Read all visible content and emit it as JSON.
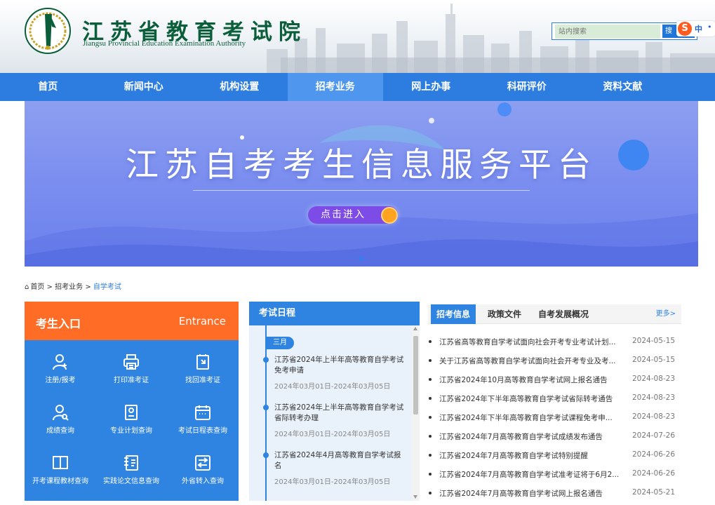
{
  "colors": {
    "nav": "#2d7de0",
    "nav_active": "#4f97ee",
    "orange": "#ff6c26",
    "logo_green": "#0b5e3a",
    "banner": "#7c8ff0"
  },
  "header": {
    "logo_cn": "江苏省教育考试院",
    "logo_en": "Jiangsu Provincial Education Examination Authority",
    "search_placeholder": "站内搜索",
    "search_button": "搜",
    "ime_s": "S",
    "ime_zh": "中",
    "ime_dot": "•"
  },
  "nav": [
    "首页",
    "新闻中心",
    "机构设置",
    "招考业务",
    "网上办事",
    "科研评价",
    "资料文献"
  ],
  "banner": {
    "title": "江苏自考考生信息服务平台",
    "enter_label": "点击进入"
  },
  "breadcrumb": {
    "home_icon": "home-icon",
    "home": "首页",
    "sep1": ">",
    "section": "招考业务",
    "sep2": ">",
    "current": "自学考试"
  },
  "entrance": {
    "title": "考生入口",
    "title_en": "Entrance",
    "items": [
      {
        "label": "注册/报考",
        "icon": "user-add-icon"
      },
      {
        "label": "打印准考证",
        "icon": "printer-icon"
      },
      {
        "label": "找回准考证",
        "icon": "recover-card-icon"
      },
      {
        "label": "成绩查询",
        "icon": "score-search-icon"
      },
      {
        "label": "专业计划查询",
        "icon": "plan-search-icon"
      },
      {
        "label": "考试日程表查询",
        "icon": "calendar-icon"
      },
      {
        "label": "开考课程教材查询",
        "icon": "book-icon"
      },
      {
        "label": "实践论文信息查询",
        "icon": "thesis-icon"
      },
      {
        "label": "外省转入查询",
        "icon": "transfer-icon"
      }
    ]
  },
  "schedule": {
    "title": "考试日程",
    "month": "三月",
    "items": [
      {
        "title": "江苏省2024年上半年高等教育自学考试免考申请",
        "date": "2024年03月01日-2024年03月05日"
      },
      {
        "title": "江苏省2024年上半年高等教育自学考试省际转考办理",
        "date": "2024年03月01日-2024年03月05日"
      },
      {
        "title": "江苏省2024年4月高等教育自学考试报名",
        "date": "2024年03月01日-2024年03月05日"
      }
    ]
  },
  "news": {
    "tabs": [
      "招考信息",
      "政策文件",
      "自考发展概况"
    ],
    "more": "更多>",
    "items": [
      {
        "title": "江苏省高等教育自学考试面向社会开考专业考试计划...",
        "date": "2024-05-15"
      },
      {
        "title": "关于江苏省高等教育自学考试面向社会开考专业及考...",
        "date": "2024-05-15"
      },
      {
        "title": "江苏省2024年10月高等教育自学考试网上报名通告",
        "date": "2024-08-23"
      },
      {
        "title": "江苏省2024年下半年高等教育自学考试省际转考通告",
        "date": "2024-08-23"
      },
      {
        "title": "江苏省2024年下半年高等教育自学考试课程免考申...",
        "date": "2024-08-23"
      },
      {
        "title": "江苏省2024年7月高等教育自学考试成绩发布通告",
        "date": "2024-07-26"
      },
      {
        "title": "江苏省2024年7月高等教育自学考试特别提醒",
        "date": "2024-06-26"
      },
      {
        "title": "江苏省2024年7月高等教育自学考试准考证将于6月2...",
        "date": "2024-06-26"
      },
      {
        "title": "江苏省2024年7月高等教育自学考试网上报名通告",
        "date": "2024-05-21"
      }
    ]
  }
}
